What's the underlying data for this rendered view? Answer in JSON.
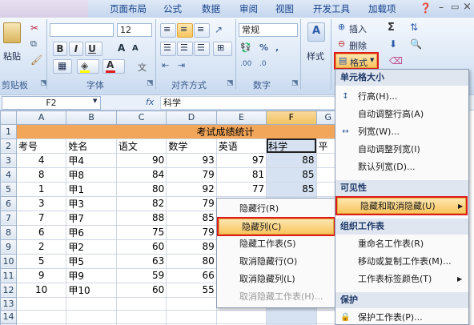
{
  "tabs": [
    "页面布局",
    "公式",
    "数据",
    "审阅",
    "视图",
    "开发工具",
    "加载项"
  ],
  "ribbon": {
    "paste_label": "粘贴",
    "clipboard_group": "剪贴板",
    "font_group": "字体",
    "align_group": "对齐方式",
    "number_group": "数字",
    "font_size": "12",
    "number_format": "常规",
    "styles_label": "样式",
    "insert_label": "插入",
    "delete_label": "删除",
    "format_label": "格式"
  },
  "formula_bar": {
    "name_box": "F2",
    "fx": "fx",
    "content": "科学"
  },
  "sheet": {
    "col_headers": [
      "A",
      "B",
      "C",
      "D",
      "E",
      "F",
      "G"
    ],
    "title": "考试成绩统计",
    "headers": [
      "考号",
      "姓名",
      "语文",
      "数学",
      "英语",
      "科学",
      "平"
    ],
    "rows": [
      [
        "4",
        "甲4",
        "90",
        "93",
        "97",
        "88",
        ""
      ],
      [
        "8",
        "甲8",
        "84",
        "79",
        "81",
        "85",
        ""
      ],
      [
        "1",
        "甲1",
        "80",
        "92",
        "77",
        "85",
        ""
      ],
      [
        "3",
        "甲3",
        "82",
        "79",
        "65",
        "",
        ""
      ],
      [
        "7",
        "甲7",
        "88",
        "85",
        "",
        "",
        ""
      ],
      [
        "6",
        "甲6",
        "75",
        "79",
        "",
        "",
        ""
      ],
      [
        "2",
        "甲2",
        "60",
        "89",
        "",
        "",
        ""
      ],
      [
        "5",
        "甲5",
        "63",
        "80",
        "",
        "",
        ""
      ],
      [
        "9",
        "甲9",
        "59",
        "66",
        "",
        "",
        ""
      ],
      [
        "10",
        "甲10",
        "60",
        "55",
        "",
        "",
        ""
      ],
      [
        "",
        "",
        "",
        "",
        "",
        "",
        ""
      ],
      [
        "",
        "",
        "",
        "",
        "",
        "",
        ""
      ],
      [
        "",
        "",
        "",
        "",
        "",
        "",
        ""
      ]
    ],
    "row_numbers": [
      "1",
      "2",
      "3",
      "4",
      "5",
      "6",
      "7",
      "8",
      "9",
      "10",
      "11",
      "12",
      "13",
      "14",
      "15"
    ]
  },
  "format_menu": {
    "section_cell_size": "单元格大小",
    "row_height": "行高(H)...",
    "autofit_row": "自动调整行高(A)",
    "col_width": "列宽(W)...",
    "autofit_col": "自动调整列宽(I)",
    "default_width": "默认列宽(D)...",
    "section_visibility": "可见性",
    "hide_unhide": "隐藏和取消隐藏(U)",
    "section_organize": "组织工作表",
    "rename_sheet": "重命名工作表(R)",
    "move_copy": "移动或复制工作表(M)...",
    "tab_color": "工作表标签颜色(T)",
    "section_protect": "保护",
    "protect_sheet": "保护工作表(P)..."
  },
  "hide_submenu": {
    "hide_rows": "隐藏行(R)",
    "hide_cols": "隐藏列(C)",
    "hide_sheet": "隐藏工作表(S)",
    "unhide_rows": "取消隐藏行(O)",
    "unhide_cols": "取消隐藏列(L)",
    "unhide_sheet": "取消隐藏工作表(H)..."
  },
  "colors": {
    "title_fill": "#f2a65a",
    "highlight_red": "#e01b1b",
    "menu_hot": "#f9c55e"
  }
}
